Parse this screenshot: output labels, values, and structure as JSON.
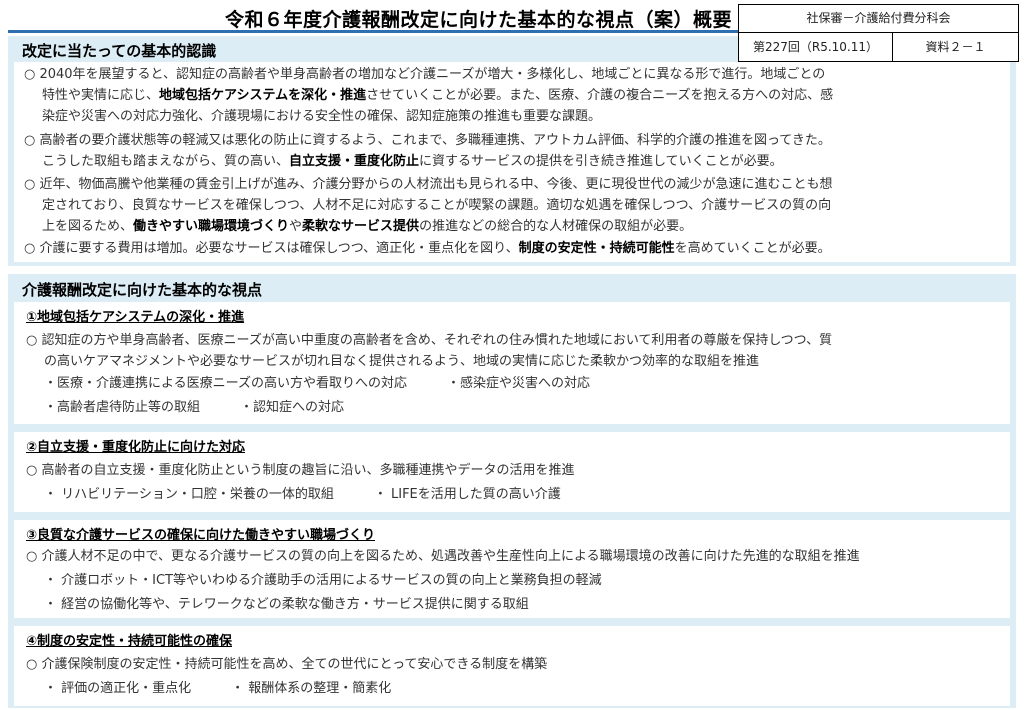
{
  "title": "令和６年度介護報酬改定に向けた基本的な視点（案）概要",
  "meta": {
    "committee": "社保審－介護給付費分科会",
    "session": "第227回（R5.10.11）",
    "document": "資料２－１"
  },
  "section1": {
    "header": "改定に当たっての基本的認識",
    "paragraphs": [
      {
        "lines": [
          [
            "○ 2040年を展望すると、認知症の高齢者や単身高齢者の増加など介護ニーズが増大・多様化し、地域ごとに異なる形で進行。地域ごとの"
          ],
          [
            "特性や実情に応じ、",
            "地域包括ケアシステムを深化・推進",
            "させていくことが必要。また、医療、介護の複合ニーズを抱える方への対応、感"
          ],
          [
            "染症や災害への対応力強化、介護現場における安全性の確保、認知症施策の推進も重要な課題。"
          ]
        ]
      },
      {
        "lines": [
          [
            "○ 高齢者の要介護状態等の軽減又は悪化の防止に資するよう、これまで、多職種連携、アウトカム評価、科学的介護の推進を図ってきた。"
          ],
          [
            "こうした取組も踏まえながら、質の高い、",
            "自立支援・重度化防止",
            "に資するサービスの提供を引き続き推進していくことが必要。"
          ]
        ]
      },
      {
        "lines": [
          [
            "○ 近年、物価高騰や他業種の賃金引上げが進み、介護分野からの人材流出も見られる中、今後、更に現役世代の減少が急速に進むことも想"
          ],
          [
            "定されており、良質なサービスを確保しつつ、人材不足に対応することが喫緊の課題。適切な処遇を確保しつつ、介護サービスの質の向"
          ],
          [
            "上を図るため、",
            "働きやすい職場環境づくり",
            "や",
            "柔軟なサービス提供",
            "の推進などの総合的な人材確保の取組が必要。"
          ]
        ]
      },
      {
        "lines": [
          [
            "○ 介護に要する費用は増加。必要なサービスは確保しつつ、適正化・重点化を図り、",
            "制度の安定性・持続可能性",
            "を高めていくことが必要。"
          ]
        ]
      }
    ]
  },
  "section2": {
    "header": "介護報酬改定に向けた基本的な視点",
    "cards": [
      {
        "title": "①地域包括ケアシステムの深化・推進",
        "lines": [
          "○ 認知症の方や単身高齢者、医療ニーズが高い中重度の高齢者を含め、それぞれの住み慣れた地域において利用者の尊厳を保持しつつ、質",
          "の高いケアマネジメントや必要なサービスが切れ目なく提供されるよう、地域の実情に応じた柔軟かつ効率的な取組を推進"
        ],
        "subs": [
          [
            "・医療・介護連携による医療ニーズの高い方や看取りへの対応",
            "・感染症や災害への対応"
          ],
          [
            "・高齢者虐待防止等の取組",
            "・認知症への対応"
          ]
        ]
      },
      {
        "title": "②自立支援・重度化防止に向けた対応",
        "lines": [
          "○ 高齢者の自立支援・重度化防止という制度の趣旨に沿い、多職種連携やデータの活用を推進"
        ],
        "subs": [
          [
            "・ リハビリテーション・口腔・栄養の一体的取組",
            "・ LIFEを活用した質の高い介護"
          ]
        ]
      },
      {
        "title": "③良質な介護サービスの確保に向けた働きやすい職場づくり",
        "lines": [
          "○ 介護人材不足の中で、更なる介護サービスの質の向上を図るため、処遇改善や生産性向上による職場環境の改善に向けた先進的な取組を推進"
        ],
        "subs": [
          [
            "・ 介護ロボット・ICT等やいわゆる介護助手の活用によるサービスの質の向上と業務負担の軽減"
          ],
          [
            "・ 経営の協働化等や、テレワークなどの柔軟な働き方・サービス提供に関する取組"
          ]
        ]
      },
      {
        "title": "④制度の安定性・持続可能性の確保",
        "lines": [
          "○ 介護保険制度の安定性・持続可能性を高め、全ての世代にとって安心できる制度を構築"
        ],
        "subs": [
          [
            "・ 評価の適正化・重点化",
            "・ 報酬体系の整理・簡素化"
          ]
        ]
      }
    ]
  }
}
